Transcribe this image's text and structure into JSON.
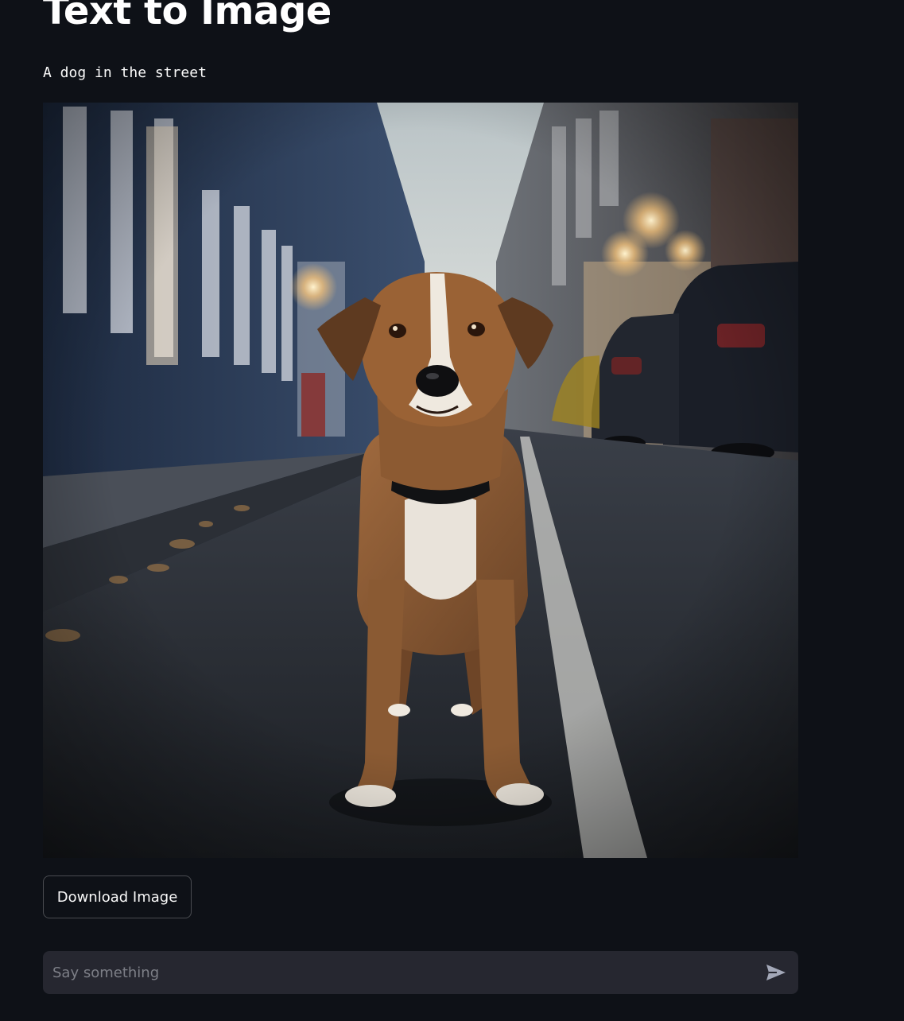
{
  "page": {
    "title": "Text to Image",
    "prompt": "A dog in the street"
  },
  "image": {
    "subject": "dog standing on a street at dusk",
    "icon": "generated-image"
  },
  "actions": {
    "download_label": "Download Image"
  },
  "chat": {
    "placeholder": "Say something",
    "value": "",
    "send_icon": "send-icon"
  },
  "colors": {
    "background": "#0e1117",
    "input_background": "#262730",
    "text": "#fafafa",
    "placeholder": "#7d7f87"
  }
}
